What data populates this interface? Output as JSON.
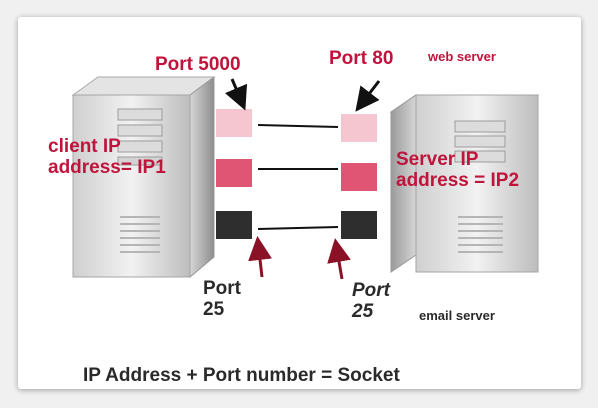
{
  "labels": {
    "client_port": "Port 5000",
    "server_port": "Port 80",
    "web_server": "web server",
    "client_ip_line1": "client IP",
    "client_ip_line2": "address= IP1",
    "server_ip_line1": "Server IP",
    "server_ip_line2": "address = IP2",
    "client_port_25_line1": "Port",
    "client_port_25_line2": "25",
    "server_port_25_line1": "Port",
    "server_port_25_line2": "25",
    "email_server": "email server",
    "equation": "IP Address + Port number = Socket"
  },
  "colors": {
    "port_light": "#f5c5d0",
    "port_mid": "#df5573",
    "port_dark": "#2e2e2e",
    "label_red": "#c0143c",
    "arrow_dark_red": "#8b1126"
  }
}
